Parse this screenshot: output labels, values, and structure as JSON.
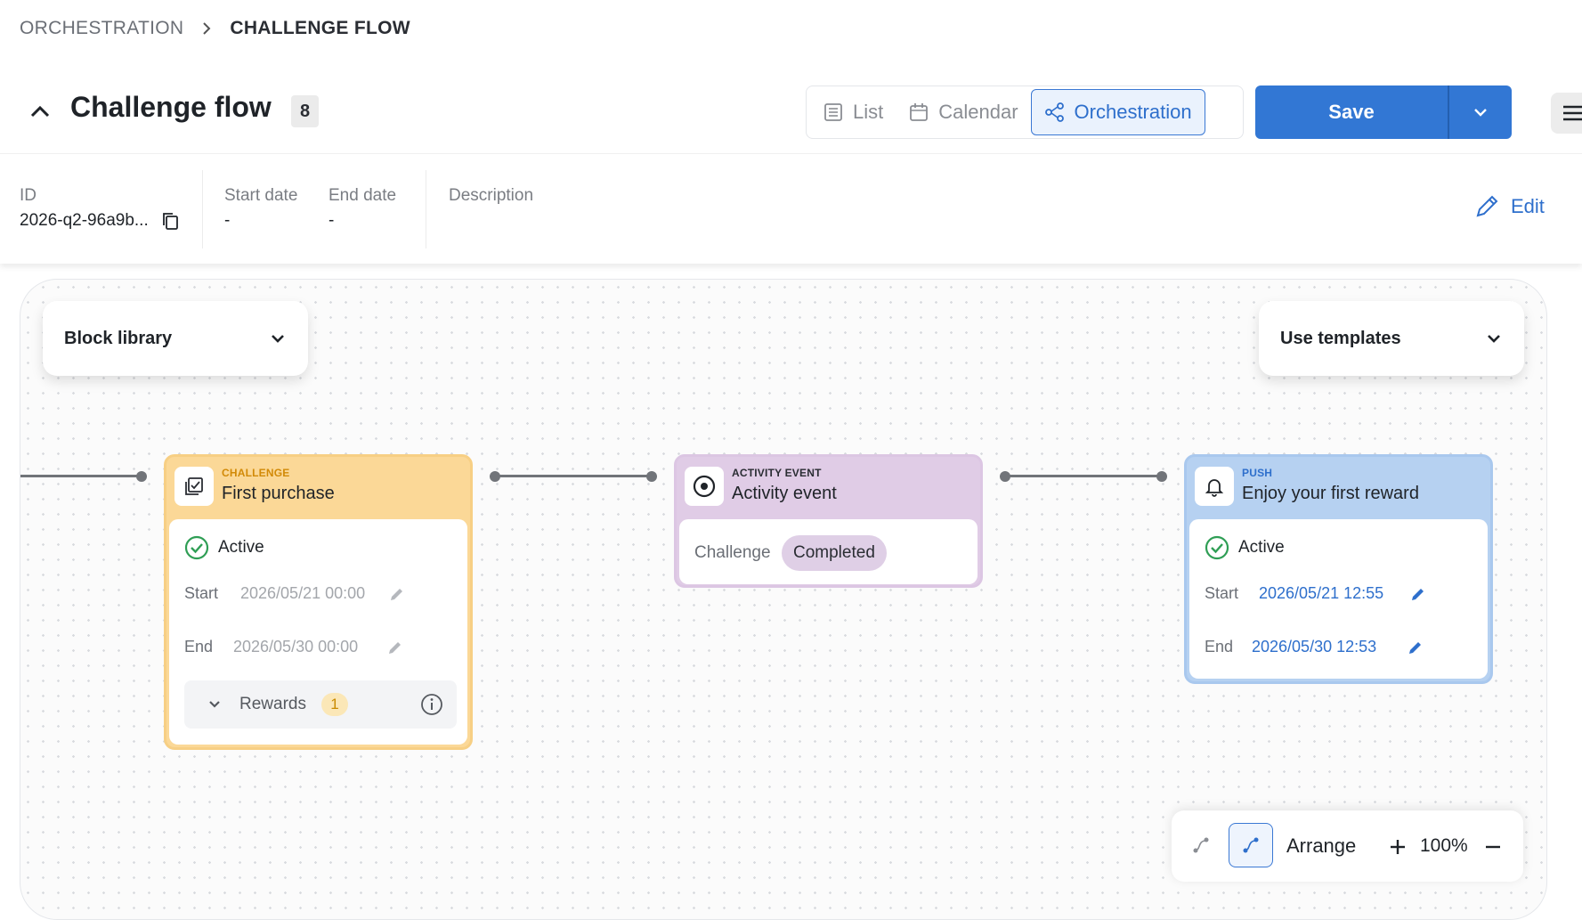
{
  "breadcrumb": {
    "root": "ORCHESTRATION",
    "current": "CHALLENGE FLOW"
  },
  "header": {
    "title": "Challenge flow",
    "count": "8",
    "views": {
      "list": "List",
      "calendar": "Calendar",
      "orchestration": "Orchestration"
    },
    "save_label": "Save"
  },
  "info": {
    "id_label": "ID",
    "id_value": "2026-q2-96a9b...",
    "start_label": "Start date",
    "start_value": "-",
    "end_label": "End date",
    "end_value": "-",
    "description_label": "Description",
    "edit_label": "Edit"
  },
  "canvas": {
    "block_library": "Block library",
    "use_templates": "Use templates",
    "nodes": [
      {
        "type": "CHALLENGE",
        "name": "First purchase",
        "status": "Active",
        "start_label": "Start",
        "start_value": "2026/05/21 00:00",
        "end_label": "End",
        "end_value": "2026/05/30 00:00",
        "rewards_label": "Rewards",
        "rewards_count": "1"
      },
      {
        "type": "ACTIVITY EVENT",
        "name": "Activity event",
        "condition_label": "Challenge",
        "condition_value": "Completed"
      },
      {
        "type": "PUSH",
        "name": "Enjoy your first reward",
        "status": "Active",
        "start_label": "Start",
        "start_value": "2026/05/21 12:55",
        "end_label": "End",
        "end_value": "2026/05/30 12:53"
      }
    ],
    "toolbar": {
      "arrange": "Arrange",
      "zoom": "100%"
    }
  },
  "colors": {
    "primary": "#3277d4",
    "challenge_head": "#fbd897",
    "challenge_border": "#f7cf84",
    "event_head": "#e0cce6",
    "event_border": "#dcc6e3",
    "push_head": "#b6d1f1",
    "push_border": "#a9c8ee",
    "active_green": "#2f9e55"
  },
  "icons": [
    "chevron-up-icon",
    "list-icon",
    "calendar-icon",
    "orchestration-icon",
    "chevron-down-icon",
    "hamburger-icon",
    "copy-icon",
    "pencil-icon",
    "checkbox-icon",
    "target-icon",
    "bell-icon",
    "check-circle-icon",
    "info-icon",
    "connector-icon",
    "plus-icon",
    "minus-icon"
  ]
}
